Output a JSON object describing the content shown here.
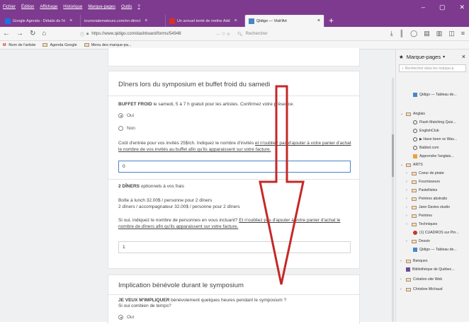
{
  "menubar": {
    "items": [
      "Fichier",
      "Édition",
      "Affichage",
      "Historique",
      "Marque-pages",
      "Outils",
      "?"
    ],
    "controls": [
      "–",
      "▢",
      "✕"
    ]
  },
  "tabs": [
    {
      "label": "Google Agenda - Détails de l'é",
      "color": "#1a73e8"
    },
    {
      "label": "tournoiatemateurs.com/en-direct",
      "color": ""
    },
    {
      "label": "Un annuel tenté de mettre Add",
      "color": "#d93025"
    },
    {
      "label": "Qidigo — Visit'Art",
      "color": "#4a86c5"
    }
  ],
  "navbar": {
    "url": "https://www.qidigo.com/dashboard/forms/54948",
    "search_placeholder": "Rechercher"
  },
  "bookmarks_bar": {
    "items": [
      "·Nom de l'artiste",
      "Agenda Google",
      "Menu des marque-pa..."
    ]
  },
  "form": {
    "section1": {
      "title": "Dîners lors du symposium et buffet froid du samedi",
      "buffet_bold": "BUFFET FROID",
      "buffet_text": " le samedi, 5 à 7 h gratuit pour les artistes.  Confirmez votre présence.",
      "options": [
        "Oui",
        "Non"
      ],
      "selected": "Oui",
      "cost_text_a": "Coût d'entrée pour vos invités 25$/ch.  Indiquez le nombre d'invités ",
      "cost_text_b": "et n'oubliez pas d'ajouter à votre panier d'achat le nombre de vos invités au buffet afin qu'ils apparaissent sur votre facture.",
      "guests_value": "0",
      "diners_bold": "2 DÎNERS",
      "diners_text": " optionnels à vos frais",
      "box_lunch": "Boîte à lunch 32.00$ / personne pour 2 dîners",
      "companion": "2 dîners / accompagnateur 32.00$ / personne pour 2 dîners",
      "people_text_a": "Si oui, indiquez le nombre de personnes en vous incluant?  ",
      "people_text_b": "Et n'oubliez pas d'ajouter à votre panier d'achat le nombre de dîners afin qu'ils apparaissent sur votre facture.",
      "people_value": "1"
    },
    "section2": {
      "title": "Implication bénévole durant le symposium",
      "involve_bold": "JE VEUX M'IMPLIQUER",
      "involve_text": " bénévolement quelques heures pendant le symposium ?",
      "how_long": "Si oui combien de temps?",
      "option_yes": "Oui"
    }
  },
  "sidebar": {
    "title": "Marque-pages",
    "search_placeholder": "Rechercher dans les marque-p",
    "items": [
      {
        "label": "Qidigo — Tableau de...",
        "type": "page"
      },
      {
        "label": "Anglais",
        "type": "folder-open"
      },
      {
        "label": "Flash Matching Quiz...",
        "type": "page"
      },
      {
        "label": "EnglishClub",
        "type": "page"
      },
      {
        "label": "▶ Have been vs Was...",
        "type": "page"
      },
      {
        "label": "Babbel.com",
        "type": "page"
      },
      {
        "label": "Apprendre l'anglais...",
        "type": "page"
      },
      {
        "label": "ARTS",
        "type": "folder-open"
      },
      {
        "label": "Coeur de pirate",
        "type": "folder"
      },
      {
        "label": "Fournisseurs",
        "type": "folder"
      },
      {
        "label": "Pastellistes",
        "type": "folder"
      },
      {
        "label": "Peintres abstraits",
        "type": "folder"
      },
      {
        "label": "Jane Davies studio",
        "type": "folder"
      },
      {
        "label": "Peintres",
        "type": "folder"
      },
      {
        "label": "Techniques",
        "type": "folder"
      },
      {
        "label": "(1) CUADROS sur Pin...",
        "type": "page"
      },
      {
        "label": "Dessin",
        "type": "folder"
      },
      {
        "label": "Qidigo — Tableau de...",
        "type": "page"
      },
      {
        "label": "Banques",
        "type": "folder"
      },
      {
        "label": "Bibliothèque de Québec...",
        "type": "page"
      },
      {
        "label": "Création site Web",
        "type": "folder"
      },
      {
        "label": "Christine Michaud",
        "type": "folder"
      }
    ]
  },
  "colors": {
    "browser_chrome": "#7e3a8f",
    "arrow": "#c62828",
    "focus_border": "#4a86c5"
  }
}
